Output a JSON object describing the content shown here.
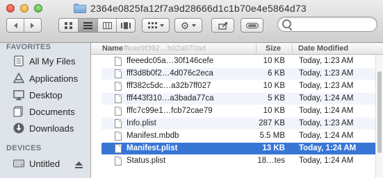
{
  "window": {
    "title": "2364e0825fa12f7a9d28666d1c1b70e4e5864d73"
  },
  "toolbar": {
    "back_icon": "chevron-left-icon",
    "forward_icon": "chevron-right-icon",
    "view_icons": [
      "icon-view-icon",
      "list-view-icon",
      "column-view-icon",
      "cover-flow-icon"
    ],
    "arrange_icon": "arrange-grid-icon",
    "action_icon": "gear-icon",
    "share_icon": "share-icon",
    "tag_icon": "tag-icon",
    "search_icon": "search-icon"
  },
  "sidebar": {
    "favorites_header": "FAVORITES",
    "devices_header": "DEVICES",
    "items": [
      {
        "label": "All My Files",
        "icon": "all-files-icon"
      },
      {
        "label": "Applications",
        "icon": "applications-icon"
      },
      {
        "label": "Desktop",
        "icon": "desktop-icon"
      },
      {
        "label": "Documents",
        "icon": "documents-icon"
      },
      {
        "label": "Downloads",
        "icon": "downloads-icon"
      }
    ],
    "devices": [
      {
        "label": "Untitled",
        "icon": "disk-icon",
        "eject_icon": "eject-icon"
      }
    ]
  },
  "columns": {
    "name": "Name",
    "size": "Size",
    "date": "Date Modified"
  },
  "ghost_row": "ffeae9f392…b02a070ad",
  "rows": [
    {
      "name": "ffeeedc05a…30f146cefe",
      "size": "10 KB",
      "date": "Today, 1:23 AM"
    },
    {
      "name": "fff3d8b0f2…4d076c2eca",
      "size": "6 KB",
      "date": "Today, 1:23 AM"
    },
    {
      "name": "fff382c5dc…a32b7ff027",
      "size": "10 KB",
      "date": "Today, 1:23 AM"
    },
    {
      "name": "fff443f310…a3bada77ca",
      "size": "5 KB",
      "date": "Today, 1:24 AM"
    },
    {
      "name": "fffc7c99e1…fcb72cae79",
      "size": "10 KB",
      "date": "Today, 1:24 AM"
    },
    {
      "name": "Info.plist",
      "size": "287 KB",
      "date": "Today, 1:23 AM"
    },
    {
      "name": "Manifest.mbdb",
      "size": "5.5 MB",
      "date": "Today, 1:24 AM"
    },
    {
      "name": "Manifest.plist",
      "size": "13 KB",
      "date": "Today, 1:24 AM",
      "selected": true
    },
    {
      "name": "Status.plist",
      "size": "18…tes",
      "date": "Today, 1:24 AM"
    }
  ]
}
